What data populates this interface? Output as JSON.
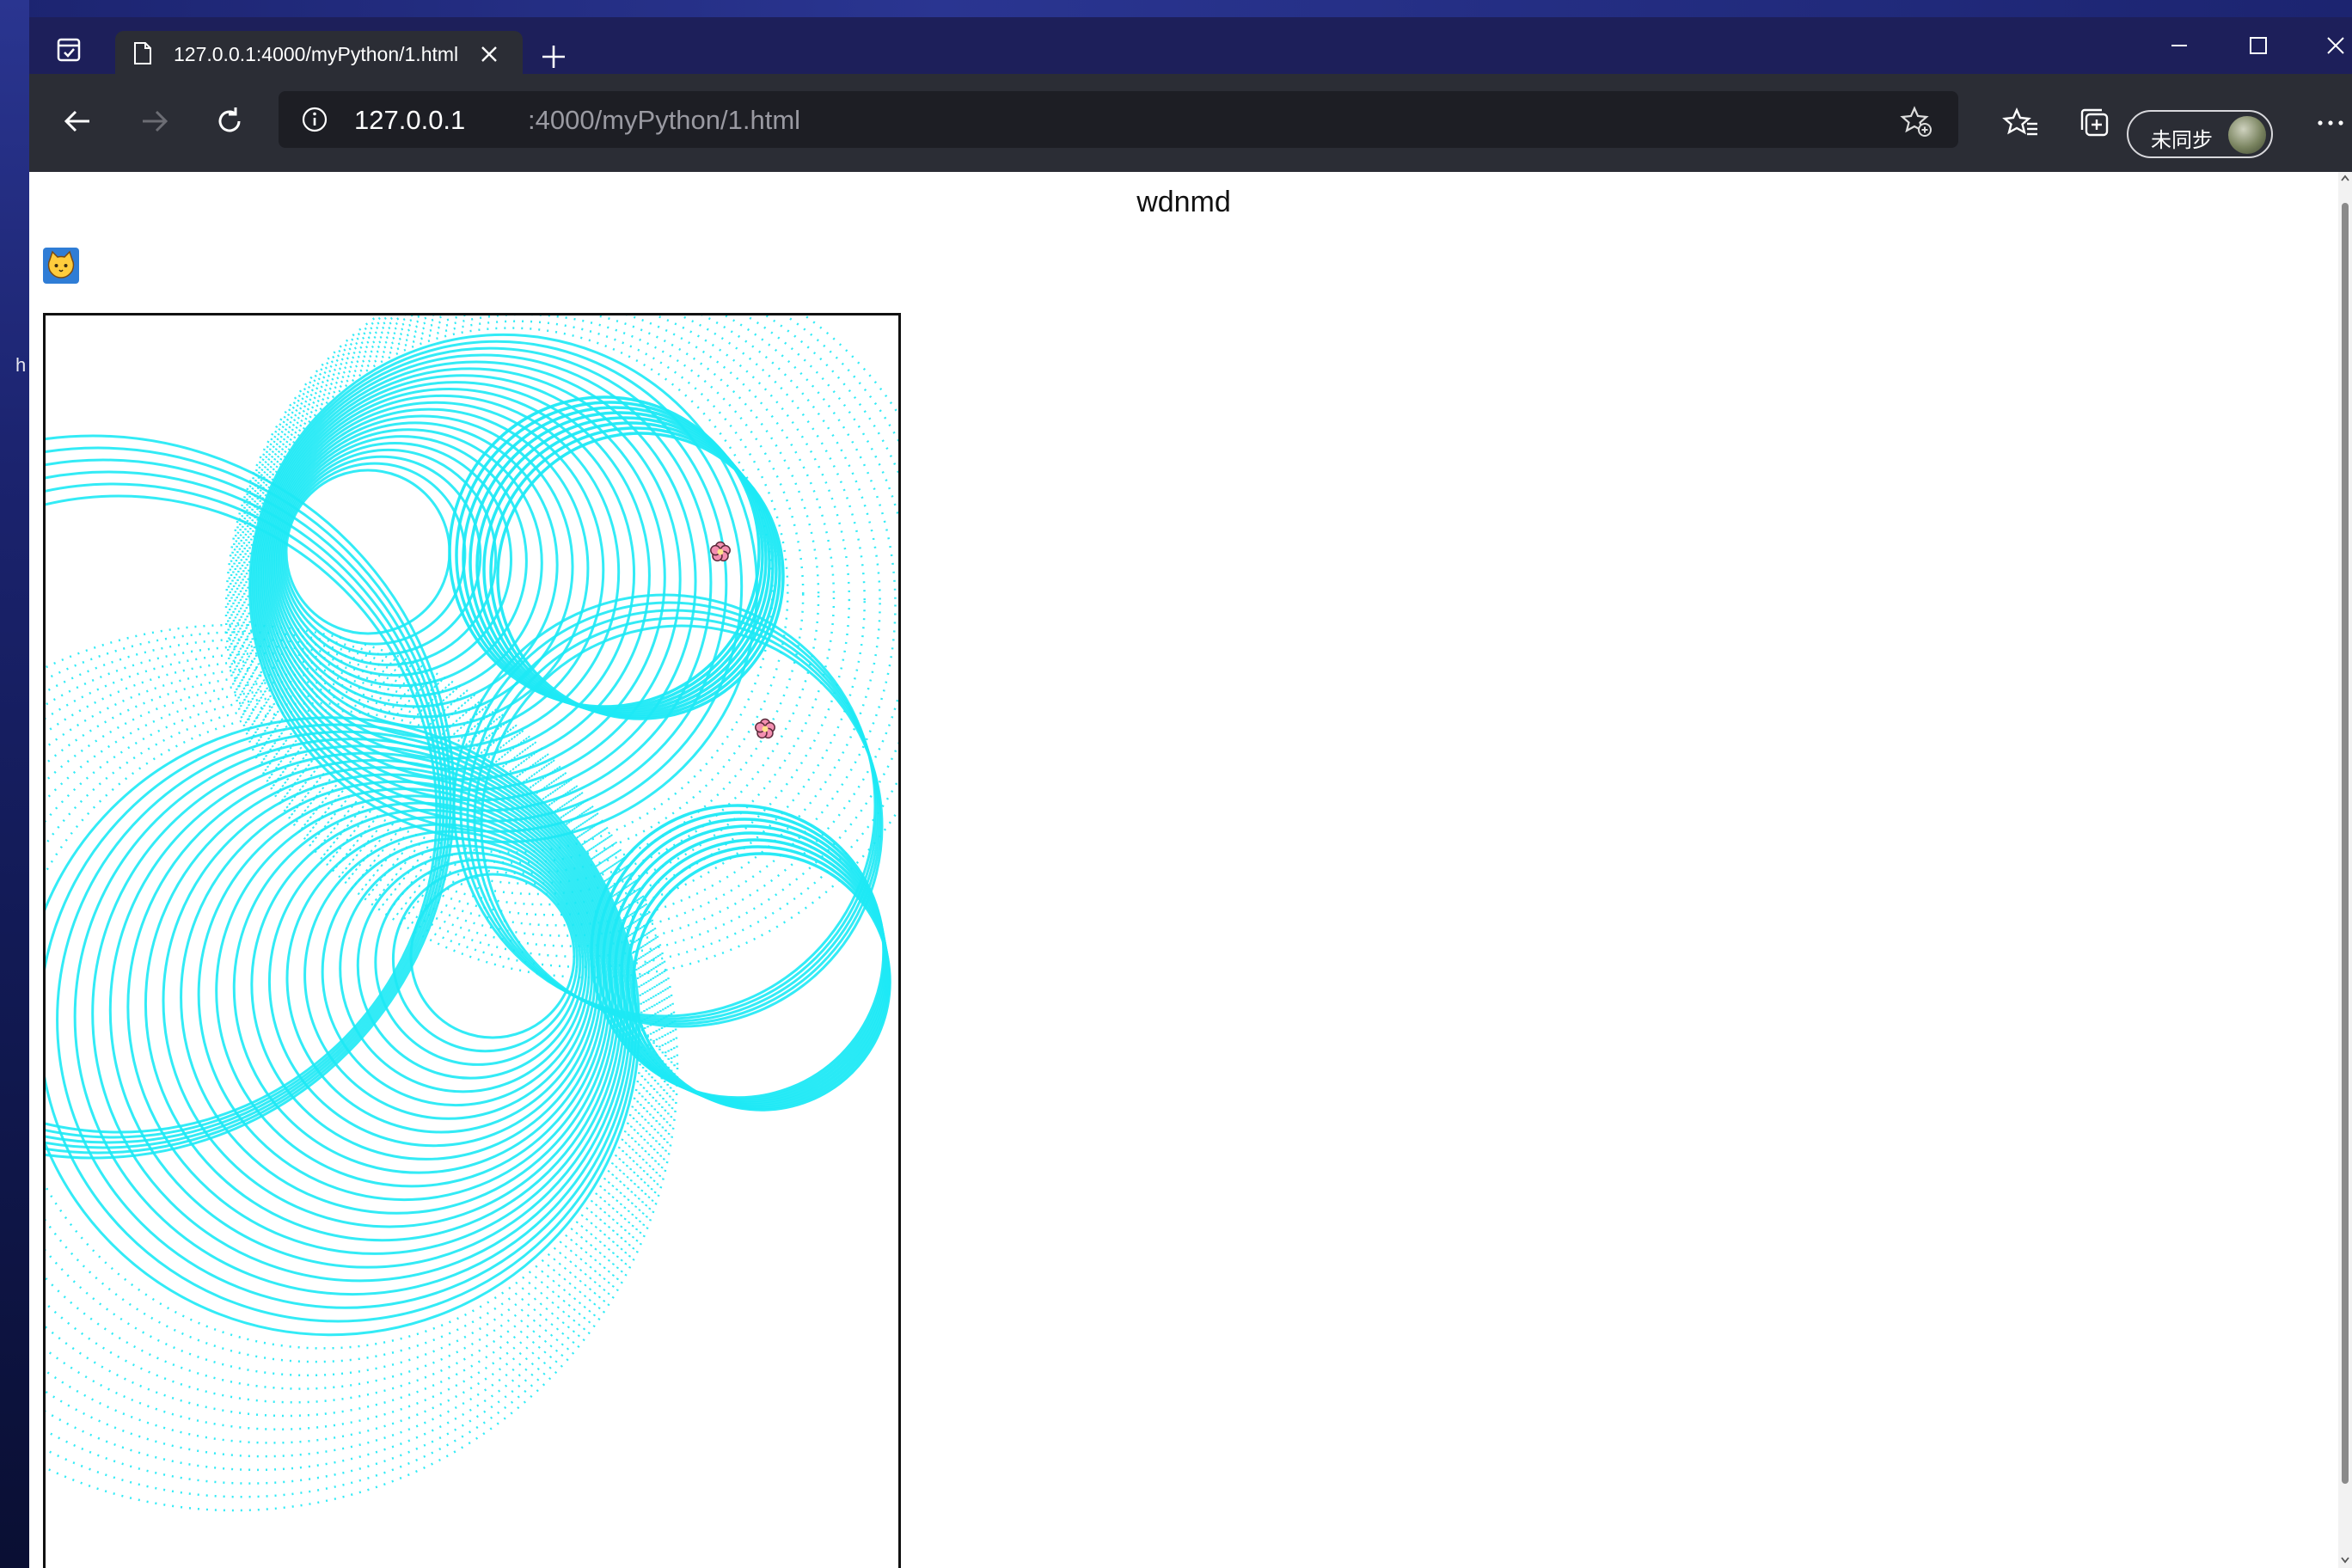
{
  "desktop": {
    "label": "h"
  },
  "browser": {
    "tab": {
      "title": "127.0.0.1:4000/myPython/1.html"
    },
    "address": {
      "host": "127.0.0.1",
      "rest": ":4000/myPython/1.html"
    },
    "profile": {
      "sync_label": "未同步"
    },
    "icons": {
      "tab_actions": "tab-actions-icon",
      "page": "page-icon",
      "close": "close-icon",
      "new_tab": "plus-icon",
      "back": "arrow-left-icon",
      "forward": "arrow-right-icon",
      "refresh": "refresh-icon",
      "info": "info-icon",
      "add_favorite": "star-plus-icon",
      "favorites": "favorites-icon",
      "collections": "collections-icon",
      "more": "more-icon"
    }
  },
  "page": {
    "heading": "wdnmd",
    "canvas": {
      "stroke_color": "#1de9f5",
      "flower_color": "#f48fb1",
      "icon": "cat-face-icon"
    }
  }
}
